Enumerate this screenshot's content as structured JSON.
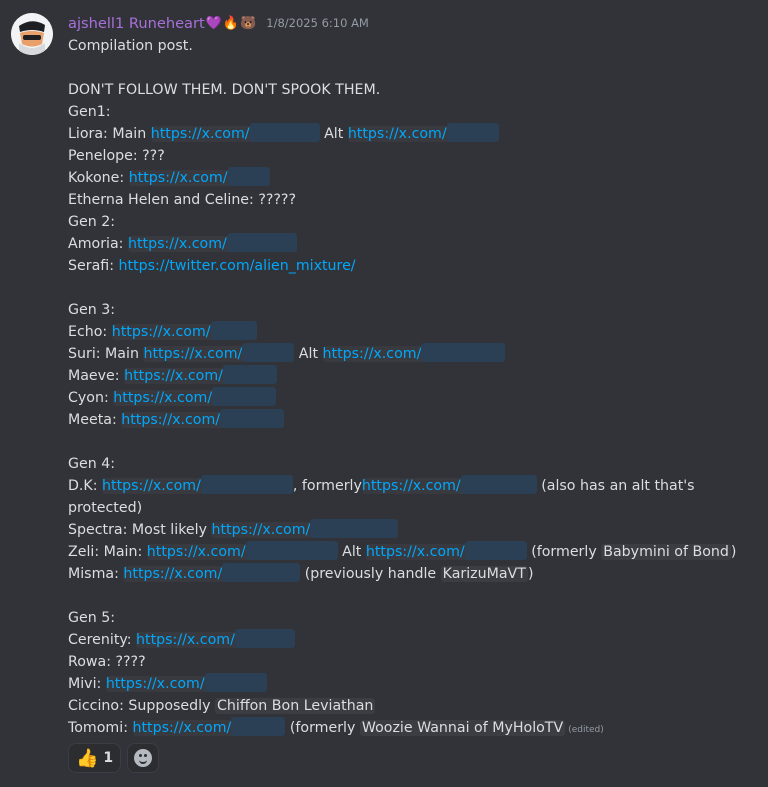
{
  "header": {
    "username": "ajshell1 Runeheart",
    "emojis": [
      "💜",
      "🔥",
      "🐻"
    ],
    "timestamp": "1/8/2025 6:10 AM"
  },
  "lines": [
    {
      "parts": [
        {
          "t": "Compilation post."
        }
      ]
    },
    {
      "parts": []
    },
    {
      "parts": [
        {
          "t": "DON'T FOLLOW THEM. DON'T SPOOK THEM."
        }
      ]
    },
    {
      "parts": [
        {
          "t": "Gen1:"
        }
      ]
    },
    {
      "parts": [
        {
          "t": "Liora: Main "
        },
        {
          "l": "https://x.com/",
          "r": 190,
          "box": 1
        },
        {
          "t": " Alt "
        },
        {
          "l": "https://x.com/",
          "r": 172,
          "box": 1
        }
      ]
    },
    {
      "parts": [
        {
          "t": "Penelope: ???"
        }
      ]
    },
    {
      "parts": [
        {
          "t": "Kokone: "
        },
        {
          "l": "https://x.com/",
          "r": 162,
          "box": 1
        }
      ]
    },
    {
      "parts": [
        {
          "t": "Etherna Helen and Celine: ?????"
        }
      ]
    },
    {
      "parts": [
        {
          "t": "Gen 2:"
        }
      ]
    },
    {
      "parts": [
        {
          "t": "Amoria: "
        },
        {
          "l": "https://x.com/",
          "r": 190,
          "box": 1
        }
      ]
    },
    {
      "parts": [
        {
          "t": "Serafi: "
        },
        {
          "l": "https://twitter.com/alien_mixture/"
        }
      ]
    },
    {
      "parts": []
    },
    {
      "parts": [
        {
          "t": "Gen 3:"
        }
      ]
    },
    {
      "parts": [
        {
          "t": "Echo: "
        },
        {
          "l": "https://x.com/",
          "r": 166,
          "box": 1
        }
      ]
    },
    {
      "parts": [
        {
          "t": "Suri: Main "
        },
        {
          "l": "https://x.com/",
          "r": 172,
          "box": 1
        },
        {
          "t": " Alt "
        },
        {
          "l": "https://x.com/",
          "r": 204,
          "box": 1
        }
      ]
    },
    {
      "parts": [
        {
          "t": "Maeve: "
        },
        {
          "l": "https://x.com/",
          "r": 174,
          "box": 1
        }
      ]
    },
    {
      "parts": [
        {
          "t": "Cyon: "
        },
        {
          "l": "https://x.com/",
          "r": 184,
          "box": 1
        }
      ]
    },
    {
      "parts": [
        {
          "t": "Meeta: "
        },
        {
          "l": "https://x.com/",
          "r": 184,
          "box": 1
        }
      ]
    },
    {
      "parts": []
    },
    {
      "parts": [
        {
          "t": "Gen 4:"
        }
      ]
    },
    {
      "parts": [
        {
          "t": "D.K: "
        },
        {
          "l": "https://x.com/",
          "r": 212,
          "box": 1
        },
        {
          "t": ", formerly"
        },
        {
          "l": "https://x.com/",
          "r": 196,
          "box": 1
        },
        {
          "t": " (also has an alt that's"
        }
      ]
    },
    {
      "parts": [
        {
          "t": "protected)"
        }
      ]
    },
    {
      "parts": [
        {
          "t": "Spectra: Most likely "
        },
        {
          "l": "https://x.com/",
          "r": 208,
          "box": 1
        }
      ]
    },
    {
      "parts": [
        {
          "t": "Zeli: Main: "
        },
        {
          "l": "https://x.com/",
          "r": 212,
          "box": 1
        },
        {
          "t": " Alt "
        },
        {
          "l": "https://x.com/",
          "r": 182,
          "box": 1
        },
        {
          "t": " (formerly "
        },
        {
          "h": "Babymini of Bond"
        },
        {
          "t": ")"
        }
      ]
    },
    {
      "parts": [
        {
          "t": "Misma: "
        },
        {
          "l": "https://x.com/",
          "r": 198,
          "box": 1
        },
        {
          "t": " (previously handle "
        },
        {
          "h": "KarizuMaVT"
        },
        {
          "t": ")"
        }
      ]
    },
    {
      "parts": []
    },
    {
      "parts": [
        {
          "t": "Gen 5:"
        }
      ]
    },
    {
      "parts": [
        {
          "t": "Cerenity: "
        },
        {
          "l": "https://x.com/",
          "r": 180,
          "box": 1
        }
      ]
    },
    {
      "parts": [
        {
          "t": "Rowa: ????"
        }
      ]
    },
    {
      "parts": [
        {
          "t": "Mivi:  "
        },
        {
          "l": "https://x.com/",
          "r": 182,
          "box": 1
        }
      ]
    },
    {
      "parts": [
        {
          "t": "Ciccino: Supposedly "
        },
        {
          "h": "Chiffon Bon Leviathan"
        }
      ]
    },
    {
      "parts": [
        {
          "t": "Tomomi:  "
        },
        {
          "l": "https://x.com/",
          "r": 174,
          "box": 1
        },
        {
          "t": " (formerly "
        },
        {
          "h": "Woozie Wannai of MyHoloTV"
        },
        {
          "e": "(edited)"
        }
      ]
    }
  ],
  "reactions": [
    {
      "emoji": "👍",
      "count": "1"
    }
  ],
  "colors": {
    "background": "#313338",
    "username": "#a970d9",
    "link": "#00a8fc",
    "redaction": "#2b3f55"
  }
}
